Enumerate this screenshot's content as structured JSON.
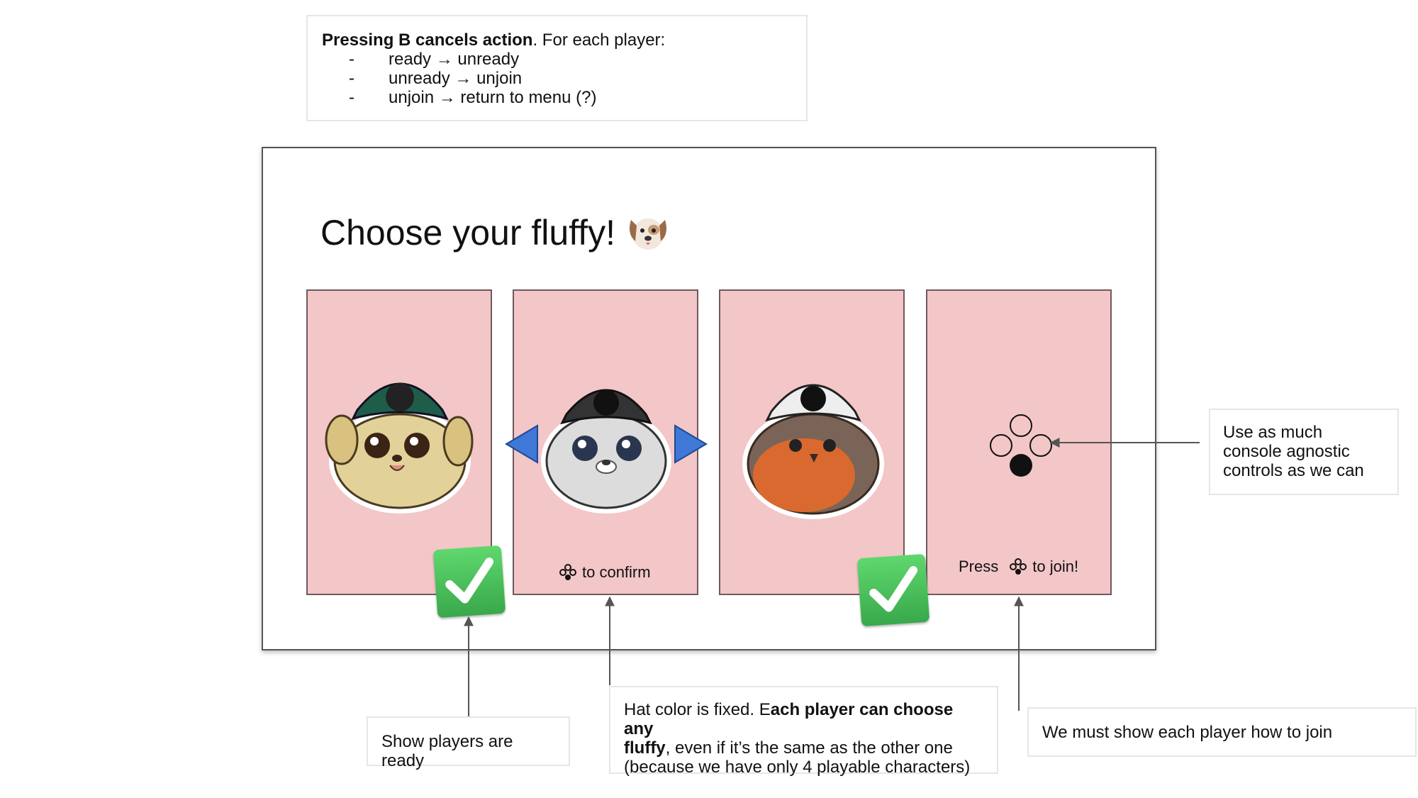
{
  "top_note": {
    "lead_bold": "Pressing B cancels action",
    "lead_rest": ". For each player:",
    "items": [
      {
        "dash": "-",
        "text": "ready → unready"
      },
      {
        "dash": "-",
        "text": "unready → unjoin"
      },
      {
        "dash": "-",
        "text": "unjoin → return to menu (?)"
      }
    ]
  },
  "mockup": {
    "title": "Choose your fluffy!",
    "title_icon": "dog-face-icon",
    "cards": [
      {
        "character": "dog-with-green-hat",
        "status": "ready"
      },
      {
        "character": "seal-with-black-hat",
        "status": "selecting",
        "prompt_icon": "button-cluster-icon",
        "prompt": "to confirm"
      },
      {
        "character": "bird-with-white-hat",
        "status": "ready"
      },
      {
        "character": "none",
        "status": "unjoined",
        "prompt_prefix": "Press",
        "prompt_icon": "button-cluster-icon",
        "prompt": "to join!"
      }
    ]
  },
  "annotations": {
    "ready": "Show players are ready",
    "hat_bold_1": "Each player can choose any fluffy",
    "hat_pre": "Hat color is fixed. E",
    "hat_bold_a": "ach player can choose any",
    "hat_bold_b": "fluffy",
    "hat_rest_1": ", even if it’s the same as the other one",
    "hat_rest_2": "(because we have only 4 playable characters)",
    "join": "We must show each player how to join",
    "controls": "Use as much console agnostic controls as we can"
  },
  "colors": {
    "card_bg": "#f3c6c8",
    "card_border": "#6d5b5d",
    "arrow_blue": "#3f78d6",
    "check_green": "#46b957"
  }
}
